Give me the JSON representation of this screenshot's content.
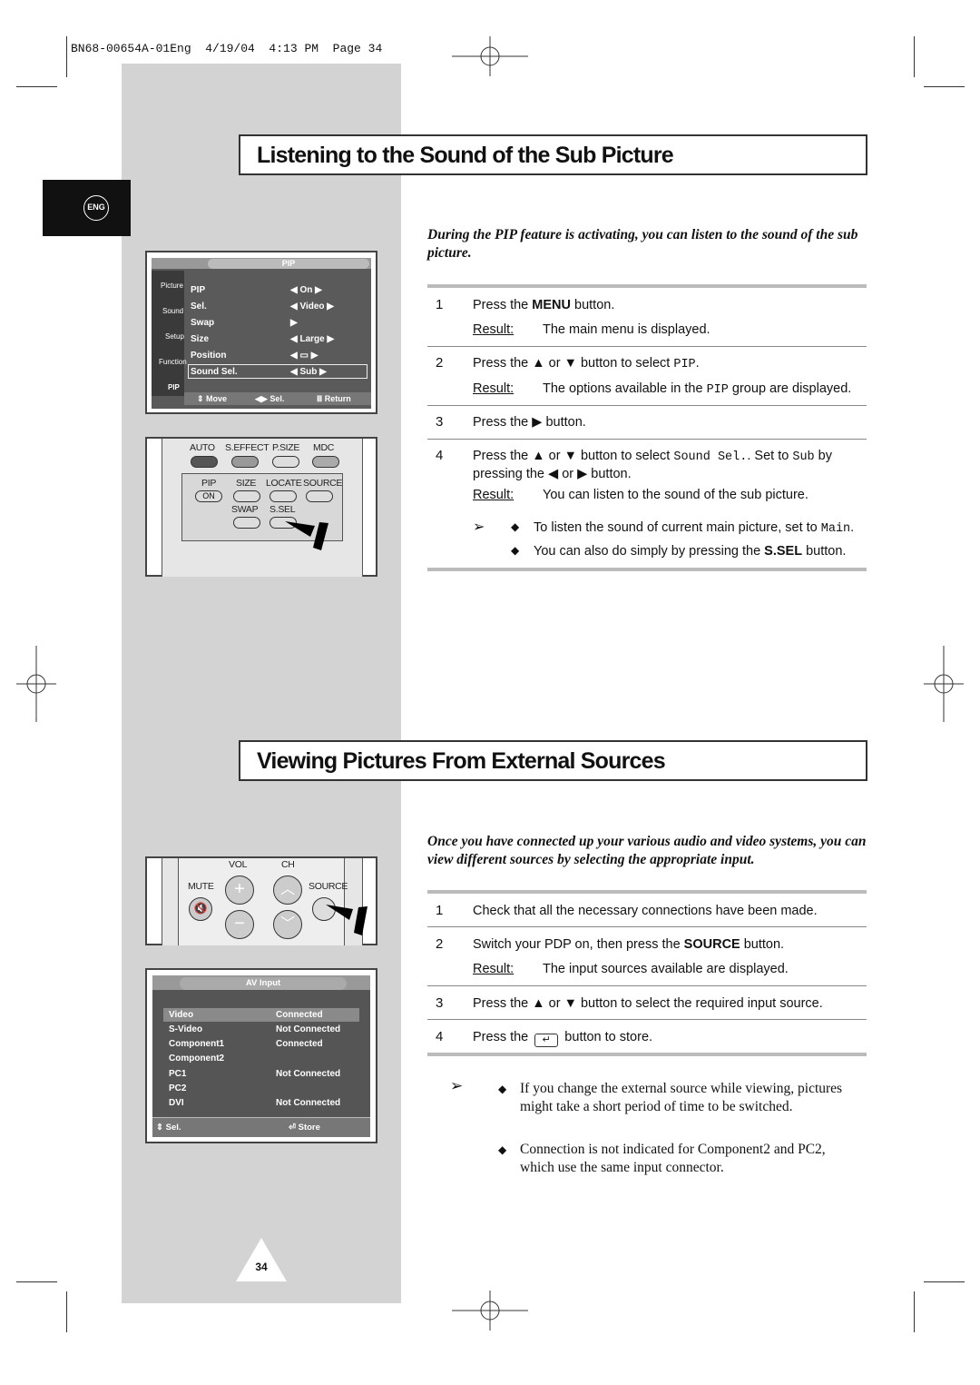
{
  "header": {
    "slug": "BN68-00654A-01Eng  4/19/04  4:13 PM  Page 34"
  },
  "lang_tab": "ENG",
  "page_number": "34",
  "section1": {
    "title": "Listening to the Sound of the Sub Picture",
    "intro": "During the PIP feature is activating, you can listen to the sound of the sub picture.",
    "result_label": "Result:",
    "steps": [
      {
        "num": "1",
        "a": "Press the ",
        "b": "MENU",
        "c": " button.",
        "result": "The main menu is displayed."
      },
      {
        "num": "2",
        "a": "Press the ▲ or ▼ button to select ",
        "m": "PIP",
        "c": ".",
        "result_a": "The options available in the ",
        "result_m": "PIP",
        "result_c": " group are displayed."
      },
      {
        "num": "3",
        "a": "Press the ▶ button."
      },
      {
        "num": "4",
        "a": "Press the ▲ or ▼ button to select ",
        "m": "Sound Sel.",
        "c": ". Set to ",
        "m2": "Sub",
        "d": " by",
        "line2": "pressing the ◀ or ▶ button.",
        "result": "You can listen to the sound of the sub picture."
      }
    ],
    "notes": [
      {
        "a": "To listen the sound of current main picture, set to ",
        "m": "Main",
        "c": "."
      },
      {
        "a": "You can also do simply by pressing the ",
        "b": "S.SEL",
        "c": " button."
      }
    ],
    "menu": {
      "title": "PIP",
      "tabs": [
        "Picture",
        "Sound",
        "Setup",
        "Function",
        "PIP"
      ],
      "rows": [
        {
          "label": "PIP",
          "value": "On"
        },
        {
          "label": "Sel.",
          "value": "Video"
        },
        {
          "label": "Swap",
          "value": ""
        },
        {
          "label": "Size",
          "value": "Large"
        },
        {
          "label": "Position",
          "value": ""
        },
        {
          "label": "Sound Sel.",
          "value": "Sub"
        }
      ],
      "footer": [
        "Move",
        "Sel.",
        "Return"
      ]
    },
    "remote": {
      "row1": [
        "AUTO",
        "S.EFFECT",
        "P.SIZE",
        "MDC"
      ],
      "row2": [
        "PIP",
        "SIZE",
        "LOCATE",
        "SOURCE"
      ],
      "on": "ON",
      "row3": [
        "SWAP",
        "S.SEL"
      ]
    }
  },
  "section2": {
    "title": "Viewing Pictures From External Sources",
    "intro": "Once you have connected up your various audio and video systems, you can view different sources by selecting the appropriate input.",
    "result_label": "Result:",
    "steps": [
      {
        "num": "1",
        "a": "Check that all the necessary connections have been made."
      },
      {
        "num": "2",
        "a": "Switch your PDP on, then press the ",
        "b": "SOURCE",
        "c": " button.",
        "result": "The input sources available are displayed."
      },
      {
        "num": "3",
        "a": "Press the ▲ or ▼ button to select the required input source."
      },
      {
        "num": "4",
        "a": "Press the ",
        "c": " button to store."
      }
    ],
    "notes": [
      "If you change the external source while viewing, pictures might take a short period of time to be switched.",
      "Connection is not indicated for Component2 and PC2, which use the same input connector."
    ],
    "remote": {
      "vol": "VOL",
      "ch": "CH",
      "mute": "MUTE",
      "source": "SOURCE"
    },
    "menu": {
      "title": "AV Input",
      "rows": [
        {
          "label": "Video",
          "value": "Connected"
        },
        {
          "label": "S-Video",
          "value": "Not Connected"
        },
        {
          "label": "Component1",
          "value": "Connected"
        },
        {
          "label": "Component2",
          "value": ""
        },
        {
          "label": "PC1",
          "value": "Not Connected"
        },
        {
          "label": "PC2",
          "value": ""
        },
        {
          "label": "DVI",
          "value": "Not Connected"
        }
      ],
      "footer": [
        "Sel.",
        "Store"
      ]
    }
  }
}
